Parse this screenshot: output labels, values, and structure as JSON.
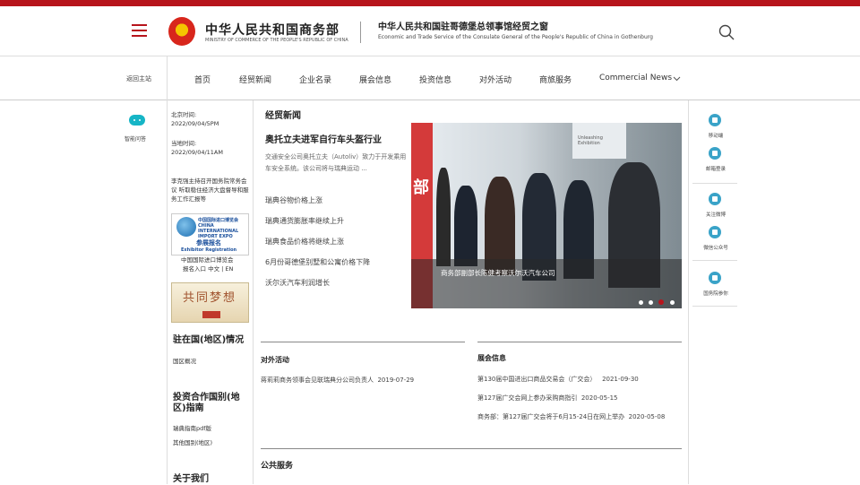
{
  "header": {
    "logo_cn": "中华人民共和国商务部",
    "logo_en": "MINISTRY OF COMMERCE OF THE PEOPLE'S REPUBLIC OF CHINA",
    "site_cn": "中华人民共和国驻哥德堡总领事馆经贸之窗",
    "site_en": "Economic and Trade Service of the Consulate General of the People's Republic of China in Gothenburg"
  },
  "nav": {
    "back": "返回主站",
    "items": [
      "首页",
      "经贸新闻",
      "企业名录",
      "展会信息",
      "投资信息",
      "对外活动",
      "商旅服务",
      "Commercial News"
    ]
  },
  "left": {
    "assistant": "智能问答",
    "beijing_label": "北京时间:",
    "beijing_time": "2022/09/04/5PM",
    "local_label": "当地时间:",
    "local_time": "2022/09/04/11AM",
    "news": "李克强主持召开国务院常务会议 听取稳住经济大盘督导和服务工作汇报等",
    "expo_title": "中国国际进口博览会 CHINA INTERNATIONAL IMPORT EXPO",
    "expo_reg": "参展报名",
    "expo_reg_en": "Exhibitor Registration",
    "expo_link": "中国国际进口博览会",
    "expo_link2": "报名入口 中文 | EN",
    "dream_text": "共同梦想",
    "country_title": "驻在国(地区)情况",
    "country_link": "国区概况",
    "invest_title": "投资合作国别(地区)指南",
    "invest_link1": "瑞典指南pdf版",
    "invest_link2": "其他国别(地区)",
    "about_title": "关于我们"
  },
  "main": {
    "section": "经贸新闻",
    "headline": "奥托立夫进军自行车头盔行业",
    "headline_desc": "交通安全公司奥托立夫（Autoliv）致力于开发乘用车安全系统。该公司将与瑞典运动 ...",
    "news": [
      "瑞典谷物价格上涨",
      "瑞典通货膨胀率继续上升",
      "瑞典食品价格将继续上涨",
      "6月份哥德堡别墅和公寓价格下降",
      "沃尔沃汽车利润增长"
    ],
    "slide_caption": "商务部副部长陈健考察沃尔沃汽车公司",
    "slide_wall_text": "部",
    "slide_window_text": "Unleashing Exhibition",
    "activities_title": "对外活动",
    "activities": [
      {
        "text": "蒋莉莉商务领事会见联瑞典分公司负责人",
        "date": "2019-07-29"
      }
    ],
    "expo_title": "展会信息",
    "expos": [
      {
        "text": "第130届中国进出口商品交易会（广交会）",
        "date": "2021-09-30"
      },
      {
        "text": "第127届广交会网上参办采购商指引",
        "date": "2020-05-15"
      },
      {
        "text": "商务部：第127届广交会将于6月15-24日在网上举办",
        "date": "2020-05-08"
      }
    ],
    "public_title": "公共服务"
  },
  "right": {
    "items": [
      "移动端",
      "邮箱登录",
      "关注微博",
      "微信公众号",
      "国务院参你"
    ]
  },
  "colors": {
    "accent": "#b7141c",
    "icon": "#3aa3c8",
    "assistant": "#16b5c6"
  }
}
